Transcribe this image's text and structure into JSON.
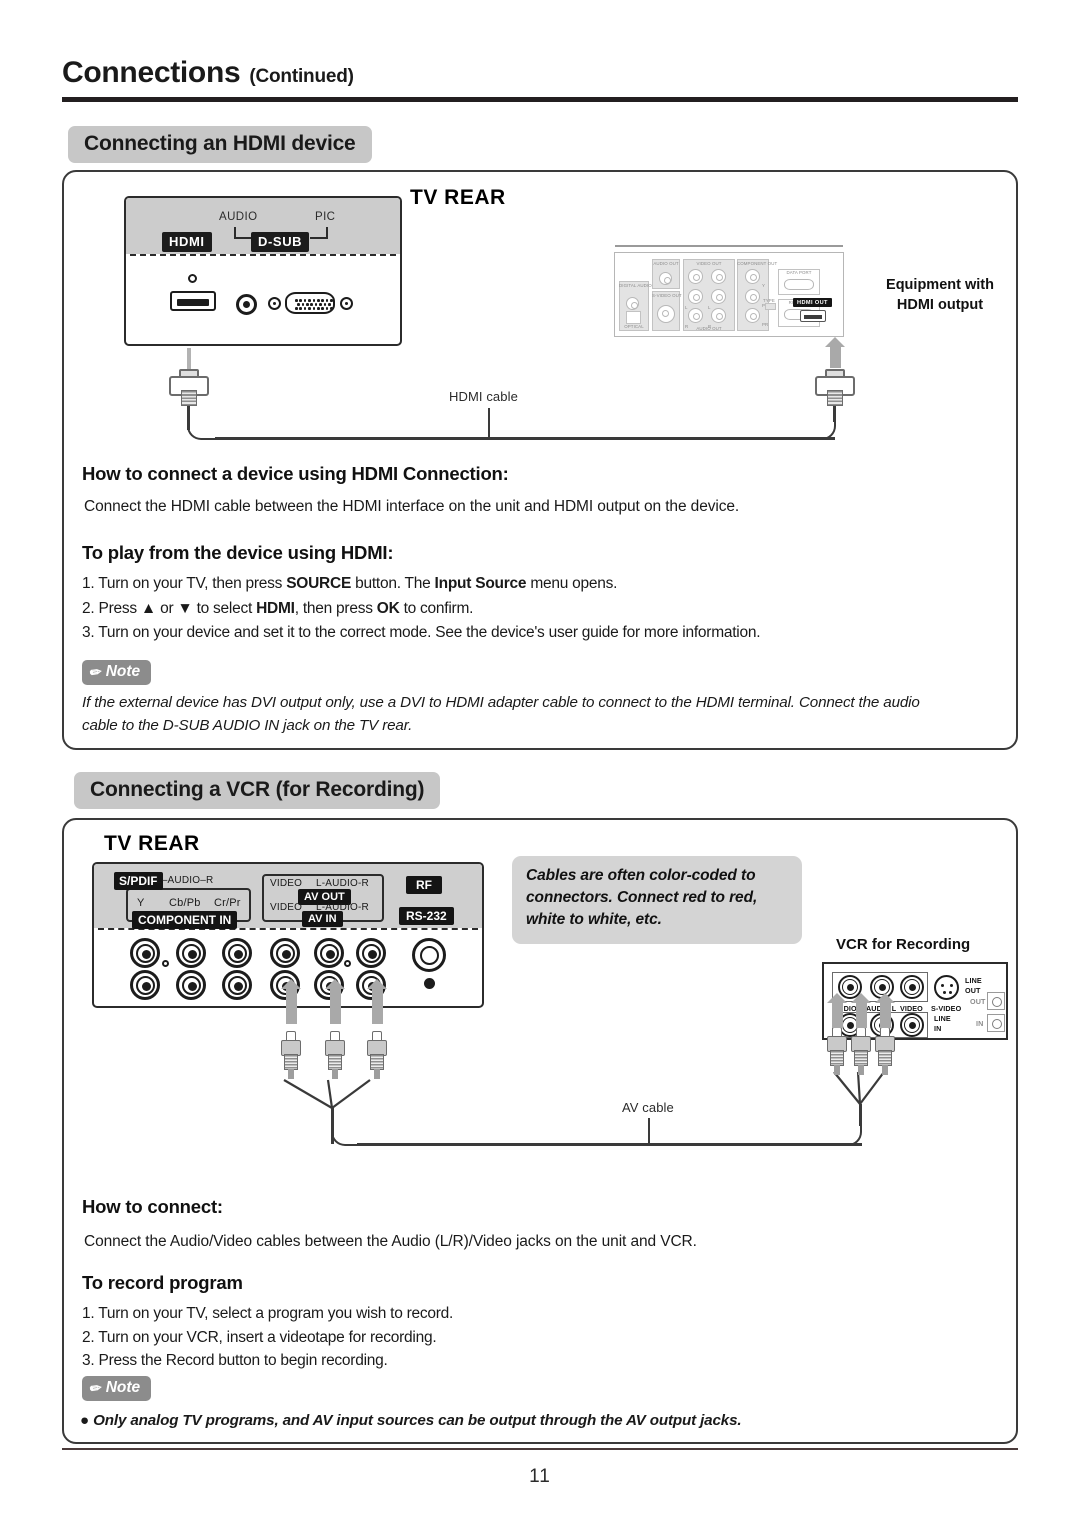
{
  "header": {
    "title": "Connections",
    "continued": "(Continued)"
  },
  "sections": {
    "hdmi": {
      "pill": "Connecting an HDMI device",
      "tv_rear_label": "TV REAR",
      "tv_panel": {
        "hdmi_label": "HDMI",
        "dsub_label": "D-SUB",
        "audio_label": "AUDIO",
        "pic_label": "PIC"
      },
      "equipment": {
        "caption_line1": "Equipment with",
        "caption_line2": "HDMI output",
        "ports": {
          "digital_audio_out": "DIGITAL AUDIO OUT",
          "optical": "OPTICAL",
          "audio_out": "AUDIO OUT",
          "s_video_out": "S-VIDEO OUT",
          "video_out": "VIDEO OUT",
          "component_out": "COMPONENT OUT",
          "audio_out_2": "AUDIO OUT",
          "data_port": "DATA PORT",
          "rgb_out": "RGB OUT",
          "hdmi_out": "HDMI OUT",
          "type": "TYPE",
          "y": "Y",
          "pb": "PB",
          "pr": "PR",
          "l1": "L",
          "l2": "L",
          "r1": "R",
          "r2": "R"
        }
      },
      "cable_label": "HDMI cable",
      "howto_heading": "How to connect a device using HDMI Connection:",
      "howto_body": "Connect the HDMI cable between the HDMI interface on the unit and HDMI output on the device.",
      "play_heading": "To play from the device using HDMI:",
      "steps": [
        {
          "num": "1.",
          "parts": [
            {
              "t": "Turn on your TV,  then press ",
              "b": false
            },
            {
              "t": "SOURCE",
              "b": true
            },
            {
              "t": " button. The ",
              "b": false
            },
            {
              "t": "Input Source",
              "b": true
            },
            {
              "t": " menu opens.",
              "b": false
            }
          ]
        },
        {
          "num": "2.",
          "parts": [
            {
              "t": "Press ",
              "b": false
            },
            {
              "t": "▲",
              "b": false
            },
            {
              "t": " or ",
              "b": false
            },
            {
              "t": "▼",
              "b": false
            },
            {
              "t": " to select ",
              "b": false
            },
            {
              "t": "HDMI",
              "b": true
            },
            {
              "t": ", then press ",
              "b": false
            },
            {
              "t": "OK",
              "b": true
            },
            {
              "t": " to confirm.",
              "b": false
            }
          ]
        },
        {
          "num": "3.",
          "parts": [
            {
              "t": "Turn on your device and set it to the correct mode. See the device's user guide for more information.",
              "b": false
            }
          ]
        }
      ],
      "note_label": "Note",
      "note_line1": "If the external device has DVI output only, use a DVI to HDMI adapter cable to connect to the HDMI terminal. Connect the audio",
      "note_line2": "cable to the D-SUB AUDIO IN jack on the TV rear."
    },
    "vcr": {
      "pill": "Connecting a VCR (for Recording)",
      "tv_rear_label": "TV REAR",
      "tv_panel": {
        "spdif": "S/PDIF",
        "l_audio_r_top": "L–AUDIO–R",
        "y": "Y",
        "cb_pb": "Cb/Pb",
        "cr_pr": "Cr/Pr",
        "component_in": "COMPONENT IN",
        "video_1": "VIDEO",
        "l_audio_r_1": "L-AUDIO-R",
        "av_out": "AV OUT",
        "video_2": "VIDEO",
        "l_audio_r_2": "L-AUDIO-R",
        "av_in": "AV IN",
        "rf": "RF",
        "rs232": "RS-232"
      },
      "callout_line1": "Cables are often color-coded to",
      "callout_line2": "connectors. Connect red to red,",
      "callout_line3": "white to white, etc.",
      "vcr_caption": "VCR for Recording",
      "vcr_panel": {
        "audio_r": "AUDIO R",
        "audio_l": "AUDIO L",
        "video": "VIDEO",
        "s_video": "S-VIDEO",
        "line_out_1": "LINE",
        "line_out_2": "OUT",
        "line_in_1": "LINE",
        "line_in_2": "IN",
        "out": "OUT",
        "in": "IN"
      },
      "cable_label": "AV cable",
      "howto_heading": "How to connect:",
      "howto_body": "Connect the Audio/Video cables between the Audio (L/R)/Video jacks on the unit and VCR.",
      "record_heading": "To record program",
      "steps": [
        {
          "num": "1.",
          "text": "Turn on your TV, select a program you wish to record."
        },
        {
          "num": "2.",
          "text": "Turn on your VCR, insert a videotape for recording."
        },
        {
          "num": "3.",
          "text": "Press the Record button to begin recording."
        }
      ],
      "note_label": "Note",
      "note_bullet": "● Only analog TV programs, and AV input sources can be output through the AV output jacks."
    }
  },
  "footer": {
    "page_number": "11"
  },
  "colors": {
    "pill_bg": "#c7c7c7",
    "callout_bg": "#d4d4d4",
    "note_badge_bg": "#8c8c8c",
    "panel_grey": "#cccccc",
    "ink": "#1a1a1a"
  }
}
